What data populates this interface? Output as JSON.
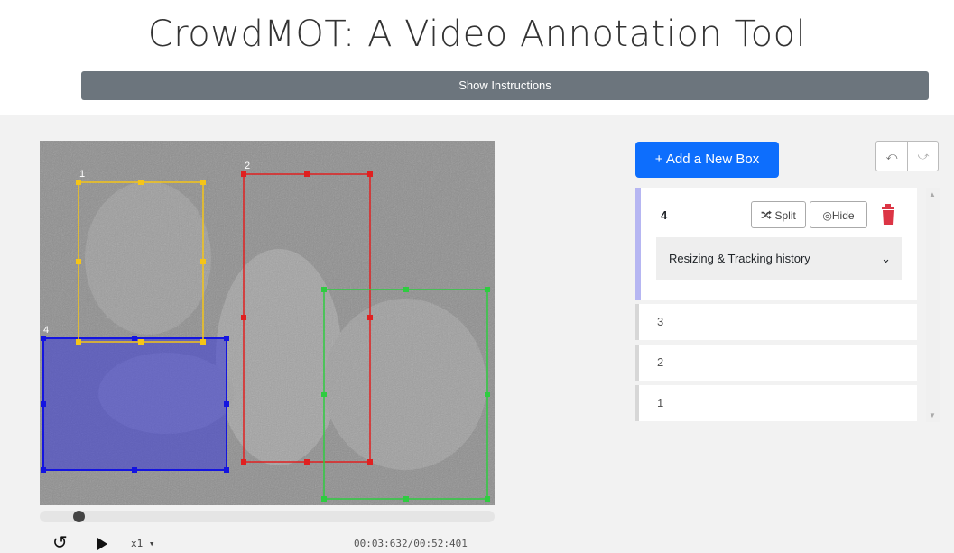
{
  "app": {
    "title": "CrowdMOT: A Video Annotation Tool",
    "instructions_button": "Show Instructions"
  },
  "video": {
    "boxes": [
      {
        "id": "1",
        "color": "#f5c518"
      },
      {
        "id": "2",
        "color": "#e02020"
      },
      {
        "id": "3",
        "color": "#2ecc40"
      },
      {
        "id": "4",
        "color": "#1414e0"
      }
    ]
  },
  "player": {
    "speed": "x1",
    "current_time": "00:03:632",
    "separator": "/",
    "total_time": "00:52:401",
    "progress_fraction": 0.076
  },
  "panel": {
    "add_box_label": "+ Add a New Box",
    "undo_icon": "undo-icon",
    "redo_icon": "redo-icon",
    "active_box": {
      "id": "4",
      "split_label": "Split",
      "hide_label": "Hide",
      "history_label": "Resizing & Tracking history"
    },
    "other_boxes": [
      "3",
      "2",
      "1"
    ]
  },
  "colors": {
    "primary": "#0d6efd",
    "secondary": "#6c757d",
    "delete": "#dc3545",
    "active_accent": "#b6b6f2"
  }
}
